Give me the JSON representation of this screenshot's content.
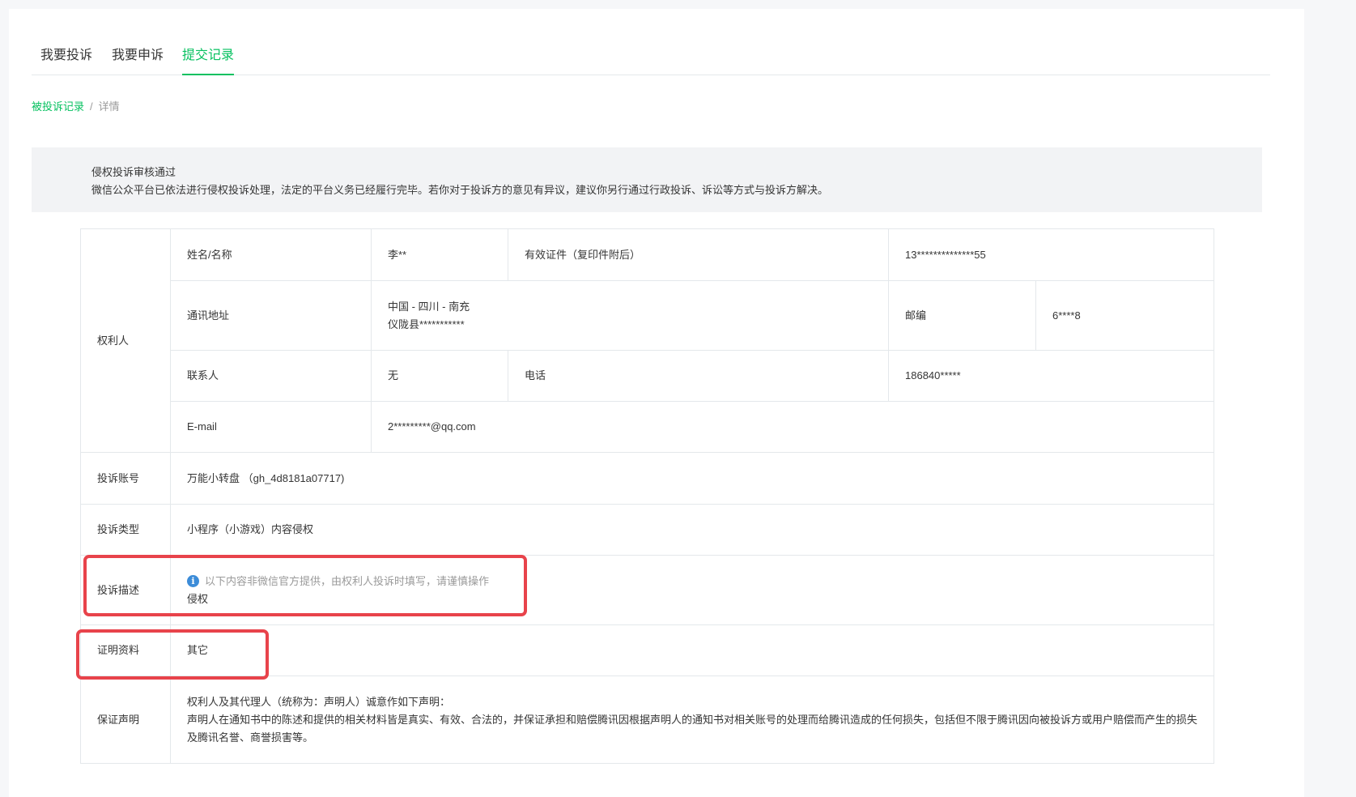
{
  "tabs": [
    {
      "label": "我要投诉",
      "active": false
    },
    {
      "label": "我要申诉",
      "active": false
    },
    {
      "label": "提交记录",
      "active": true
    }
  ],
  "breadcrumb": {
    "parent": "被投诉记录",
    "separator": "/",
    "current": "详情"
  },
  "notice": {
    "title": "侵权投诉审核通过",
    "body": "微信公众平台已依法进行侵权投诉处理，法定的平台义务已经履行完毕。若你对于投诉方的意见有异议，建议你另行通过行政投诉、诉讼等方式与投诉方解决。"
  },
  "rights_holder": {
    "section_label": "权利人",
    "name_label": "姓名/名称",
    "name_value": "李**",
    "id_label": "有效证件（复印件附后）",
    "id_value": "13**************55",
    "address_label": "通讯地址",
    "address_line1": "中国 - 四川 - 南充",
    "address_line2": "仪陇县***********",
    "postcode_label": "邮编",
    "postcode_value": "6****8",
    "contact_label": "联系人",
    "contact_value": "无",
    "phone_label": "电话",
    "phone_value": "186840*****",
    "email_label": "E-mail",
    "email_value": "2*********@qq.com"
  },
  "account": {
    "label": "投诉账号",
    "value": "万能小转盘 （gh_4d8181a07717)"
  },
  "complaint_type": {
    "label": "投诉类型",
    "value": "小程序（小游戏）内容侵权"
  },
  "description": {
    "label": "投诉描述",
    "hint": "以下内容非微信官方提供，由权利人投诉时填写，请谨慎操作",
    "value": "侵权"
  },
  "evidence": {
    "label": "证明资料",
    "value": "其它"
  },
  "statement": {
    "label": "保证声明",
    "line1": "权利人及其代理人（统称为：声明人）诚意作如下声明：",
    "line2": "声明人在通知书中的陈述和提供的相关材料皆是真实、有效、合法的，并保证承担和赔偿腾讯因根据声明人的通知书对相关账号的处理而给腾讯造成的任何损失，包括但不限于腾讯因向被投诉方或用户赔偿而产生的损失及腾讯名誉、商誉损害等。"
  },
  "colors": {
    "accent": "#07c160",
    "highlight": "#e8434b",
    "info": "#3c8cd8"
  }
}
